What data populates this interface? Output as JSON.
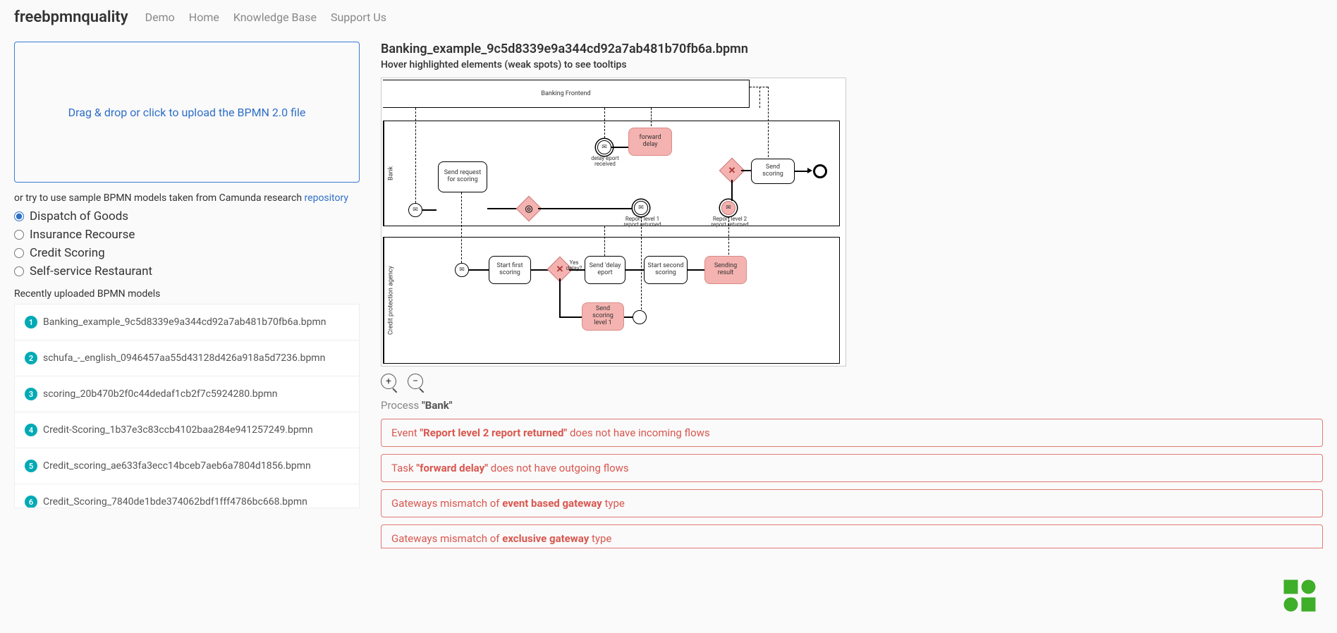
{
  "brand": "freebpmnquality",
  "nav": [
    "Demo",
    "Home",
    "Knowledge Base",
    "Support Us"
  ],
  "dropzone": "Drag & drop or click to upload the BPMN 2.0 file",
  "samples_intro_pre": "or try to use sample BPMN models taken from Camunda research ",
  "samples_intro_link": "repository",
  "samples": [
    {
      "label": "Dispatch of Goods",
      "checked": true
    },
    {
      "label": "Insurance Recourse",
      "checked": false
    },
    {
      "label": "Credit Scoring",
      "checked": false
    },
    {
      "label": "Self-service Restaurant",
      "checked": false
    }
  ],
  "recent_label": "Recently uploaded BPMN models",
  "recent": [
    "Banking_example_9c5d8339e9a344cd92a7ab481b70fb6a.bpmn",
    "schufa_-_english_0946457aa55d43128d426a918a5d7236.bpmn",
    "scoring_20b470b2f0c44dedaf1cb2f7c5924280.bpmn",
    "Credit-Scoring_1b37e3c83ccb4102baa284e941257249.bpmn",
    "Credit_scoring_ae633fa3ecc14bceb7aeb6a7804d1856.bpmn",
    "Credit_Scoring_7840de1bde374062bdf1fff4786bc668.bpmn"
  ],
  "file_title": "Banking_example_9c5d8339e9a344cd92a7ab481b70fb6a.bpmn",
  "hint": "Hover highlighted elements (weak spots) to see tooltips",
  "diagram": {
    "pool_top_label": "Banking Frontend",
    "pool_mid_label": "Bank",
    "pool_bot_label": "Credit protection agency",
    "tasks": {
      "send_request": "Send request for scoring",
      "forward_delay": "forward delay",
      "send_scoring": "Send scoring",
      "start_first": "Start first scoring",
      "send_delay": "Send 'delay eport",
      "start_second": "Start second scoring",
      "sending_result": "Sending result",
      "send_scoring_l1": "Send scoring level 1"
    },
    "labels": {
      "delay_eport_recv": "delay eport received",
      "report_l1": "Report level 1 report returned",
      "report_l2": "Report level 2 report returned",
      "yes_delay": "Yes delay?"
    }
  },
  "process_prefix": "Process ",
  "process_name": "\"Bank\"",
  "issues": [
    {
      "pre": "Event ",
      "bold": "\"Report level 2 report returned\"",
      "post": " does not have incoming flows"
    },
    {
      "pre": "Task ",
      "bold": "\"forward delay\"",
      "post": " does not have outgoing flows"
    },
    {
      "pre": "Gateways mismatch of ",
      "bold": "event based gateway",
      "post": " type"
    },
    {
      "pre": "Gateways mismatch of ",
      "bold": "exclusive gateway",
      "post": " type"
    }
  ]
}
